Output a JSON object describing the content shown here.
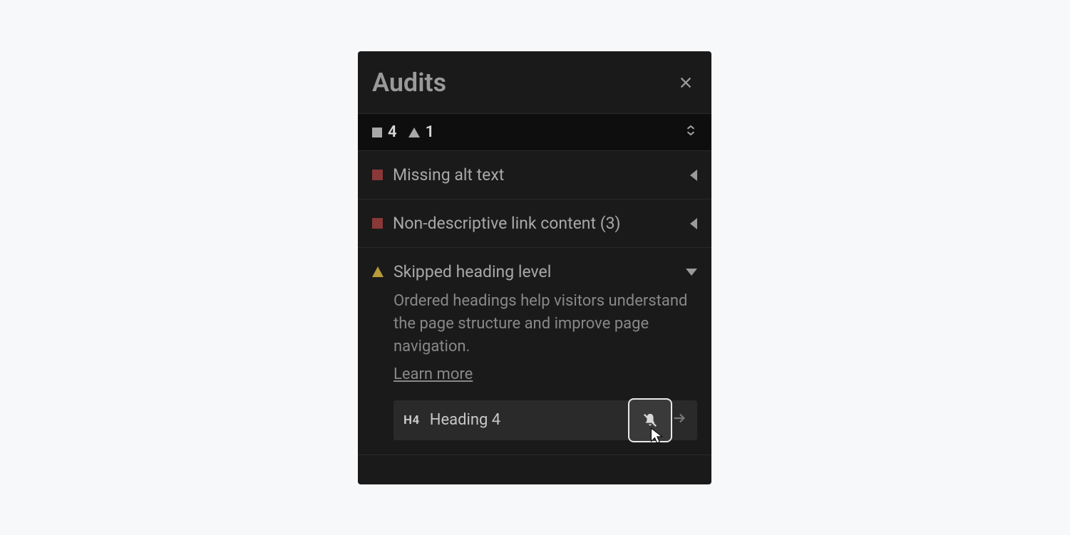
{
  "panel": {
    "title": "Audits",
    "summary": {
      "errors": "4",
      "warnings": "1"
    },
    "items": [
      {
        "type": "error",
        "label": "Missing alt text"
      },
      {
        "type": "error",
        "label": "Non-descriptive link content (3)"
      },
      {
        "type": "warning",
        "label": "Skipped heading level",
        "description": "Ordered headings help visitors understand the page structure and improve page navigation.",
        "learn_more": "Learn more",
        "element": {
          "badge": "H4",
          "name": "Heading 4"
        }
      }
    ]
  }
}
